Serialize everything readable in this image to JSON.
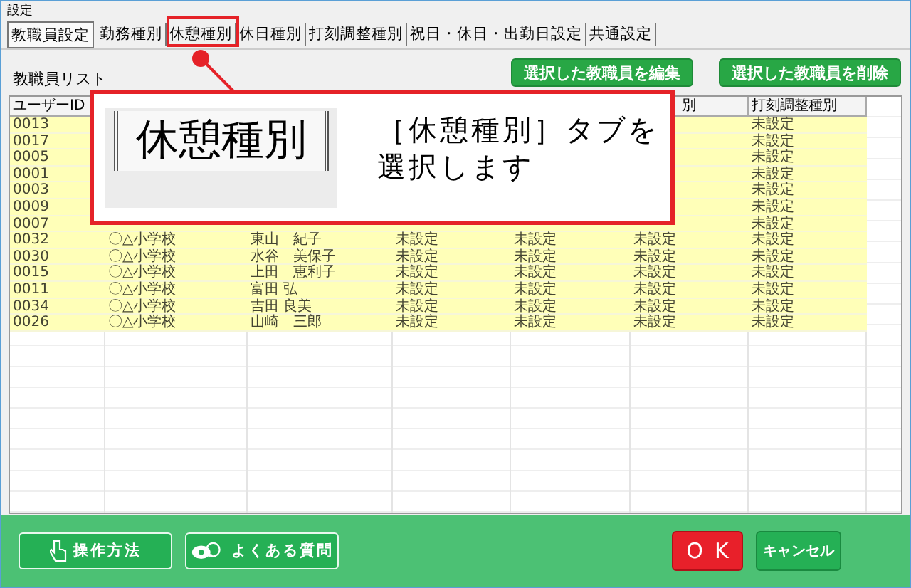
{
  "window": {
    "title": "設定"
  },
  "tabs": [
    {
      "label": "教職員設定",
      "selected": true
    },
    {
      "label": "勤務種別",
      "selected": false
    },
    {
      "label": "休憩種別",
      "selected": false
    },
    {
      "label": "休日種別",
      "selected": false
    },
    {
      "label": "打刻調整種別",
      "selected": false
    },
    {
      "label": "祝日・休日・出勤日設定",
      "selected": false
    },
    {
      "label": "共通設定",
      "selected": false
    }
  ],
  "list_label": "教職員リスト",
  "actions": [
    "選択した教職員を編集",
    "選択した教職員を削除"
  ],
  "table": {
    "columns": {
      "user_id": "ユーザーID",
      "column_6": "別",
      "column_7": "打刻調整種別"
    },
    "rows": [
      {
        "user_id": "0013",
        "column_7": "未設定"
      },
      {
        "user_id": "0017",
        "column_7": "未設定"
      },
      {
        "user_id": "0005",
        "column_7": "未設定"
      },
      {
        "user_id": "0001",
        "column_7": "未設定"
      },
      {
        "user_id": "0003",
        "column_7": "未設定"
      },
      {
        "user_id": "0009",
        "column_7": "未設定"
      },
      {
        "user_id": "0007",
        "column_7": "未設定"
      },
      {
        "user_id": "0032",
        "school": "〇△小学校",
        "name": "東山　紀子",
        "column_4": "未設定",
        "column_5": "未設定",
        "column_6": "未設定",
        "column_7": "未設定"
      },
      {
        "user_id": "0030",
        "school": "〇△小学校",
        "name": "水谷　美保子",
        "column_4": "未設定",
        "column_5": "未設定",
        "column_6": "未設定",
        "column_7": "未設定"
      },
      {
        "user_id": "0015",
        "school": "〇△小学校",
        "name": "上田　恵利子",
        "column_4": "未設定",
        "column_5": "未設定",
        "column_6": "未設定",
        "column_7": "未設定"
      },
      {
        "user_id": "0011",
        "school": "〇△小学校",
        "name": "富田 弘",
        "column_4": "未設定",
        "column_5": "未設定",
        "column_6": "未設定",
        "column_7": "未設定"
      },
      {
        "user_id": "0034",
        "school": "〇△小学校",
        "name": "吉田 良美",
        "column_4": "未設定",
        "column_5": "未設定",
        "column_6": "未設定",
        "column_7": "未設定"
      },
      {
        "user_id": "0026",
        "school": "〇△小学校",
        "name": "山崎　三郎",
        "column_4": "未設定",
        "column_5": "未設定",
        "column_6": "未設定",
        "column_7": "未設定"
      }
    ]
  },
  "callout": {
    "tab_label": "休憩種別",
    "lines": [
      "［休憩種別］タブを",
      "選択します"
    ]
  },
  "footer": {
    "buttons": [
      {
        "label": "操作方法",
        "kind": "help"
      },
      {
        "label": "よくある質問",
        "kind": "faq"
      }
    ],
    "ok": "OK",
    "cancel": "キャンセル"
  }
}
